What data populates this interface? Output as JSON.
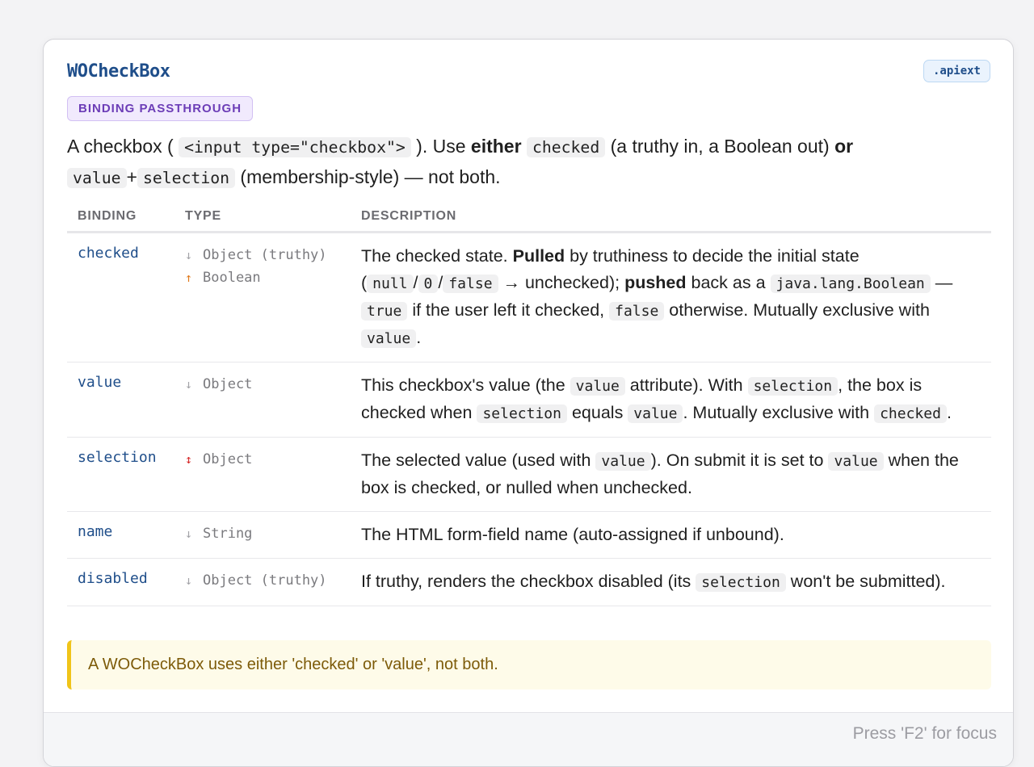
{
  "component": {
    "title": "WOCheckBox",
    "apiext_label": ".apiext",
    "badge": "BINDING PASSTHROUGH"
  },
  "lead": {
    "t1": "A checkbox ( ",
    "c1": "<input type=\"checkbox\">",
    "t2": " ). Use ",
    "b1": "either",
    "t3": " ",
    "c2": "checked",
    "t4": " (a truthy in, a Boolean out) ",
    "b2": "or",
    "c3": "value",
    "t5": "+",
    "c4": "selection",
    "t6": " (membership-style) — not both."
  },
  "table": {
    "headers": [
      "BINDING",
      "TYPE",
      "DESCRIPTION"
    ],
    "rows": [
      {
        "binding": "checked",
        "types": [
          {
            "arrow": "↓",
            "dir": "in",
            "text": "Object (truthy)"
          },
          {
            "arrow": "↑",
            "dir": "out",
            "text": "Boolean"
          }
        ],
        "desc": [
          {
            "t": "The checked state. "
          },
          {
            "b": "Pulled"
          },
          {
            "t": " by truthiness to decide the initial state ("
          },
          {
            "c": "null"
          },
          {
            "t": "/"
          },
          {
            "c": "0"
          },
          {
            "t": "/"
          },
          {
            "c": "false"
          },
          {
            "t": " → unchecked); "
          },
          {
            "b": "pushed"
          },
          {
            "t": " back as a "
          },
          {
            "c": "java.lang.Boolean"
          },
          {
            "t": " — "
          },
          {
            "c": "true"
          },
          {
            "t": " if the user left it checked, "
          },
          {
            "c": "false"
          },
          {
            "t": " otherwise. Mutually exclusive with "
          },
          {
            "c": "value"
          },
          {
            "t": "."
          }
        ]
      },
      {
        "binding": "value",
        "types": [
          {
            "arrow": "↓",
            "dir": "in",
            "text": "Object"
          }
        ],
        "desc": [
          {
            "t": "This checkbox's value (the "
          },
          {
            "c": "value"
          },
          {
            "t": " attribute). With "
          },
          {
            "c": "selection"
          },
          {
            "t": ", the box is checked when "
          },
          {
            "c": "selection"
          },
          {
            "t": " equals "
          },
          {
            "c": "value"
          },
          {
            "t": ". Mutually exclusive with "
          },
          {
            "c": "checked"
          },
          {
            "t": "."
          }
        ]
      },
      {
        "binding": "selection",
        "types": [
          {
            "arrow": "↕",
            "dir": "both",
            "text": "Object"
          }
        ],
        "desc": [
          {
            "t": "The selected value (used with "
          },
          {
            "c": "value"
          },
          {
            "t": "). On submit it is set to "
          },
          {
            "c": "value"
          },
          {
            "t": " when the box is checked, or nulled when unchecked."
          }
        ]
      },
      {
        "binding": "name",
        "types": [
          {
            "arrow": "↓",
            "dir": "in",
            "text": "String"
          }
        ],
        "desc": [
          {
            "t": "The HTML form-field name (auto-assigned if unbound)."
          }
        ]
      },
      {
        "binding": "disabled",
        "types": [
          {
            "arrow": "↓",
            "dir": "in",
            "text": "Object (truthy)"
          }
        ],
        "desc": [
          {
            "t": "If truthy, renders the checkbox disabled (its "
          },
          {
            "c": "selection"
          },
          {
            "t": " won't be submitted)."
          }
        ]
      }
    ]
  },
  "warning": "A WOCheckBox uses either 'checked' or 'value', not both.",
  "footer": {
    "hint": "Press 'F2' for focus"
  },
  "colors": {
    "accent": "#1f4e8a",
    "badge": "#6c3db7",
    "arrow_out": "#e0781a",
    "arrow_both": "#d62b2b",
    "warning_border": "#f0c419"
  }
}
